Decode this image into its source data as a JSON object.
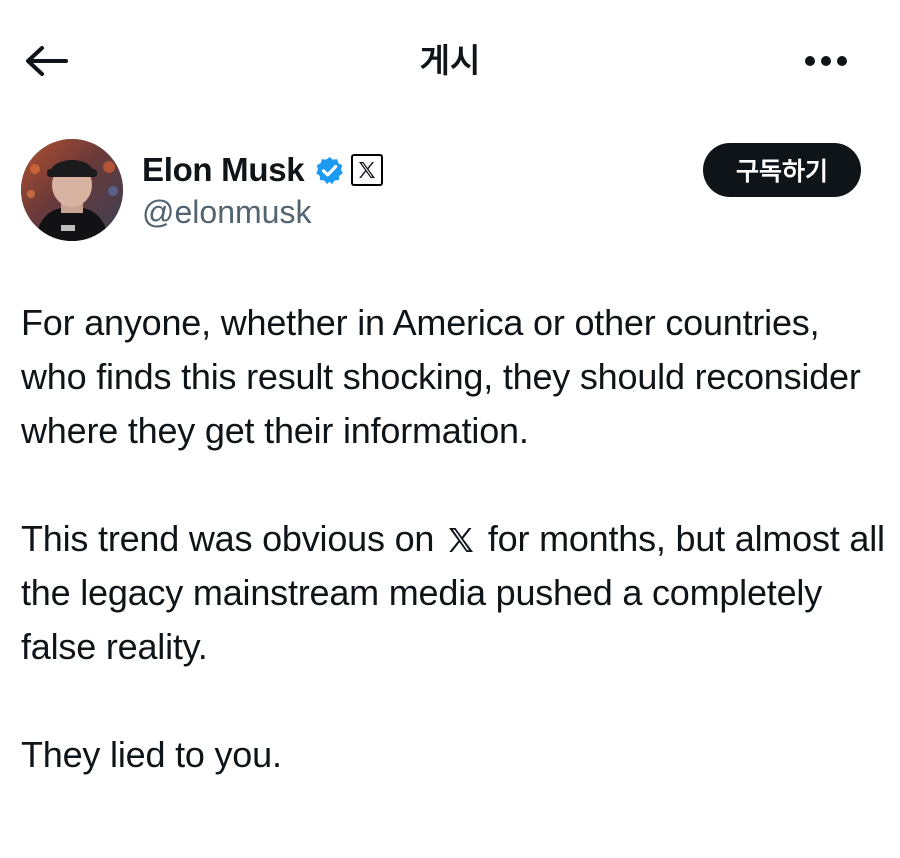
{
  "header": {
    "back_icon": "arrow-left-icon",
    "title": "게시",
    "more_icon": "more-horizontal-icon"
  },
  "author": {
    "name": "Elon Musk",
    "handle": "@elonmusk",
    "verified_icon": "verified-badge-icon",
    "affiliation_icon": "x-logo-icon",
    "verified_color": "#1d9bf0"
  },
  "actions": {
    "subscribe_label": "구독하기"
  },
  "post": {
    "paragraph1": "For anyone, whether in America or other countries, who finds this result shocking, they should reconsider where they get their information.",
    "paragraph2_before": "This trend was obvious on",
    "paragraph2_icon": "x-logo-icon",
    "paragraph2_after": "for months, but almost all the legacy mainstream media pushed a completely false reality.",
    "paragraph3": "They lied to you."
  }
}
